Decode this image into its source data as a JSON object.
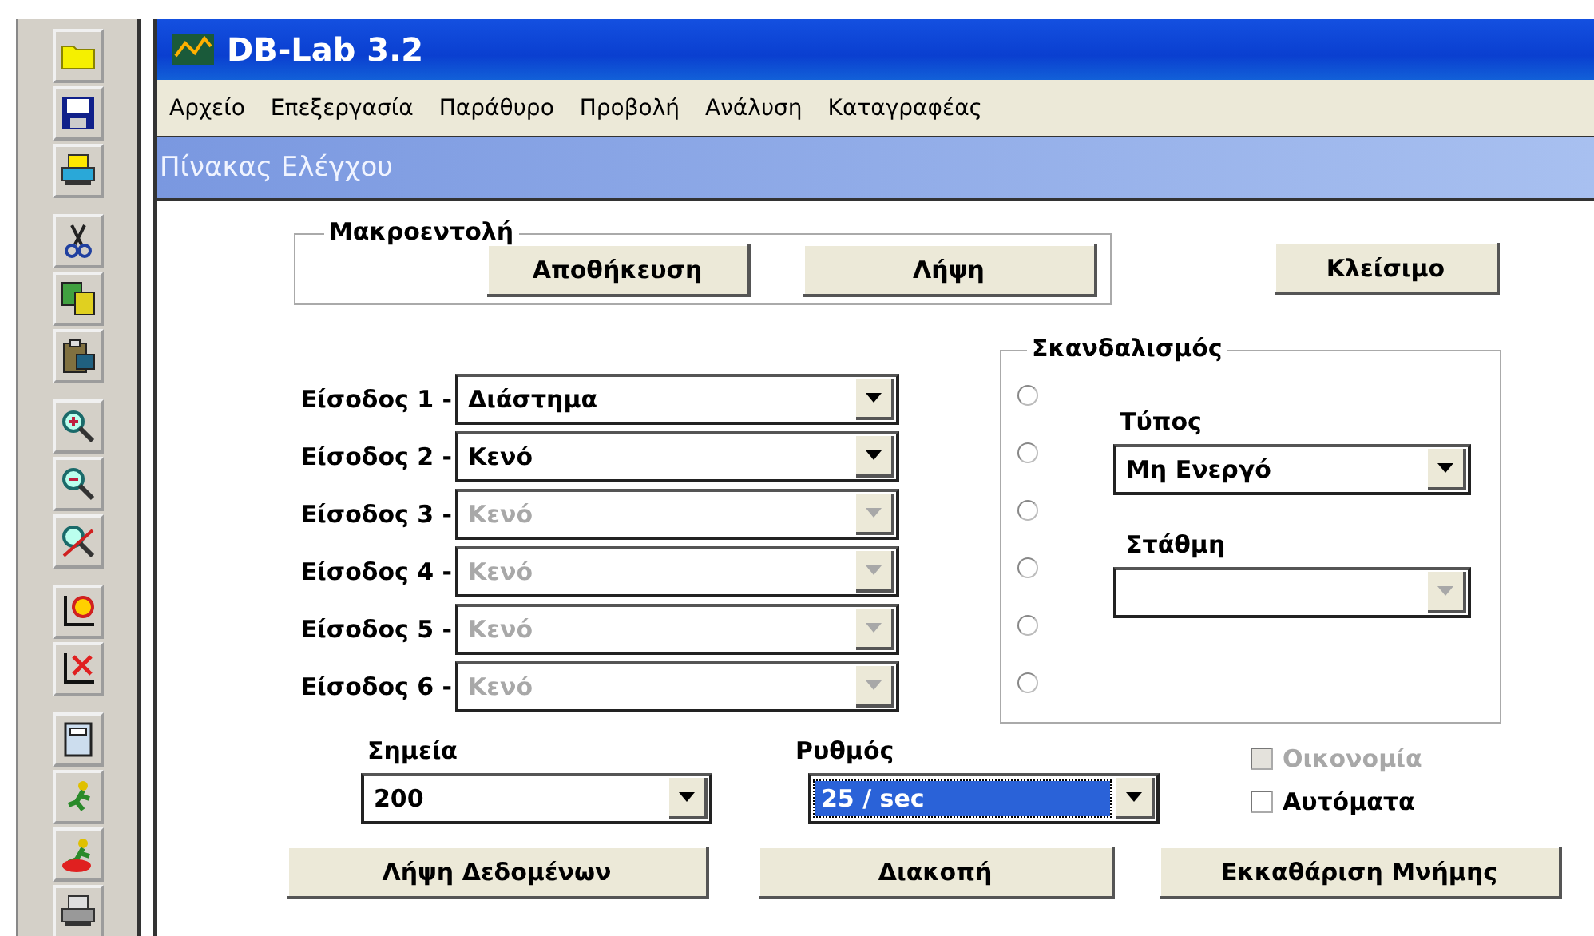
{
  "window": {
    "title": "DB-Lab 3.2"
  },
  "menu": [
    "Αρχείο",
    "Επεξεργασία",
    "Παράθυρο",
    "Προβολή",
    "Ανάλυση",
    "Καταγραφέας"
  ],
  "panel": {
    "title": "Πίνακας Ελέγχου"
  },
  "macro": {
    "legend": "Μακροεντολή",
    "buttons": [
      "Αποθήκευση",
      "Λήψη"
    ]
  },
  "close_button": "Κλείσιμο",
  "inputs": [
    {
      "label": "Είσοδος 1 -",
      "value": "Διάστημα",
      "disabled": false
    },
    {
      "label": "Είσοδος 2 -",
      "value": "Κενό",
      "disabled": false
    },
    {
      "label": "Είσοδος 3 -",
      "value": "Κενό",
      "disabled": true
    },
    {
      "label": "Είσοδος 4 -",
      "value": "Κενό",
      "disabled": true
    },
    {
      "label": "Είσοδος 5 -",
      "value": "Κενό",
      "disabled": true
    },
    {
      "label": "Είσοδος 6 -",
      "value": "Κενό",
      "disabled": true
    }
  ],
  "trigger": {
    "legend": "Σκανδαλισμός",
    "radios": [
      {
        "selected": false
      },
      {
        "selected": false
      },
      {
        "selected": false
      },
      {
        "selected": false
      },
      {
        "selected": false
      },
      {
        "selected": false
      }
    ],
    "type": {
      "label": "Τύπος",
      "value": "Μη Ενεργό",
      "disabled": false
    },
    "level": {
      "label": "Στάθμη",
      "disabled": true
    }
  },
  "points": {
    "label": "Σημεία",
    "value": "200"
  },
  "rate": {
    "label": "Ρυθμός",
    "value": "25 / sec",
    "focused": true
  },
  "checkboxes": [
    {
      "label": "Οικονομία",
      "checked": false,
      "disabled": true
    },
    {
      "label": "Αυτόματα",
      "checked": false,
      "disabled": false
    }
  ],
  "buttons": [
    "Λήψη Δεδομένων",
    "Διακοπή",
    "Εκκαθάριση Μνήμης"
  ]
}
